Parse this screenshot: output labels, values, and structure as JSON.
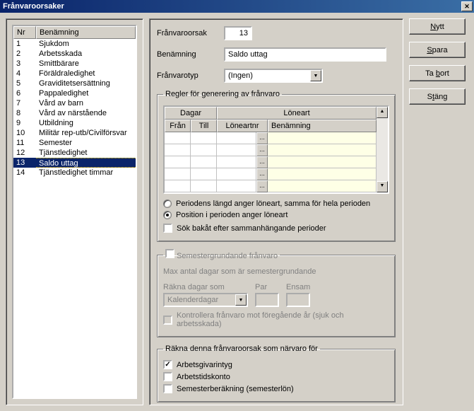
{
  "title": "Frånvaroorsaker",
  "list": {
    "headers": {
      "nr": "Nr",
      "ben": "Benämning"
    },
    "rows": [
      {
        "nr": "1",
        "ben": "Sjukdom"
      },
      {
        "nr": "2",
        "ben": "Arbetsskada"
      },
      {
        "nr": "3",
        "ben": "Smittbärare"
      },
      {
        "nr": "4",
        "ben": "Föräldraledighet"
      },
      {
        "nr": "5",
        "ben": "Graviditetsersättning"
      },
      {
        "nr": "6",
        "ben": "Pappaledighet"
      },
      {
        "nr": "7",
        "ben": "Vård av barn"
      },
      {
        "nr": "8",
        "ben": "Vård av närstående"
      },
      {
        "nr": "9",
        "ben": "Utbildning"
      },
      {
        "nr": "10",
        "ben": "Militär rep-utb/Civilförsvar"
      },
      {
        "nr": "11",
        "ben": "Semester"
      },
      {
        "nr": "12",
        "ben": "Tjänstledighet"
      },
      {
        "nr": "13",
        "ben": "Saldo uttag",
        "selected": true
      },
      {
        "nr": "14",
        "ben": "Tjänstledighet timmar"
      }
    ]
  },
  "form": {
    "code_label": "Frånvaroorsak",
    "code": "13",
    "name_label": "Benämning",
    "name": "Saldo uttag",
    "type_label": "Frånvarotyp",
    "type_value": "(Ingen)"
  },
  "rules": {
    "legend": "Regler för generering av frånvaro",
    "hdr_dagar": "Dagar",
    "hdr_loneart": "Löneart",
    "hdr_fran": "Från",
    "hdr_till": "Till",
    "hdr_loneartnr": "Löneartnr",
    "hdr_ben": "Benämning",
    "cell_btn": "...",
    "radio1": "Periodens längd anger löneart, samma för hela perioden",
    "radio2": "Position i perioden anger löneart",
    "check_back": "Sök bakåt efter sammanhängande perioder"
  },
  "sem": {
    "legend": "Semestergrundande frånvaro",
    "max_label": "Max antal dagar som är semestergrundande",
    "rakna_label": "Räkna dagar som",
    "par_label": "Par",
    "ensam_label": "Ensam",
    "combo_value": "Kalenderdagar",
    "kontroll": "Kontrollera frånvaro mot föregående år (sjuk och arbetsskada)"
  },
  "narvaro": {
    "legend": "Räkna denna frånvaroorsak som närvaro för",
    "c1": "Arbetsgivarintyg",
    "c2": "Arbetstidskonto",
    "c3": "Semesterberäkning (semesterlön)"
  },
  "buttons": {
    "new": "Nytt",
    "save": "Spara",
    "del": "Ta bort",
    "close": "Stäng"
  }
}
